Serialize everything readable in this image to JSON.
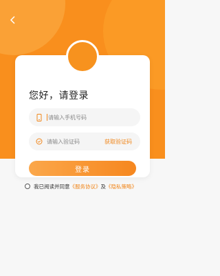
{
  "header": {
    "back_icon": "chevron-left-icon"
  },
  "login": {
    "title": "您好，请登录",
    "phone": {
      "placeholder": "请输入手机号码",
      "value": ""
    },
    "code": {
      "placeholder": "请输入验证码",
      "value": ""
    },
    "get_code_label": "获取验证码",
    "submit_label": "登录"
  },
  "agreement": {
    "prefix": "我已阅读并同意",
    "service_link": "《服务协议》",
    "joiner": "及",
    "privacy_link": "《隐私策略》",
    "checked": false
  },
  "colors": {
    "accent": "#f98f1d",
    "accent_light": "#fba74a",
    "background": "#f7f7f7"
  }
}
